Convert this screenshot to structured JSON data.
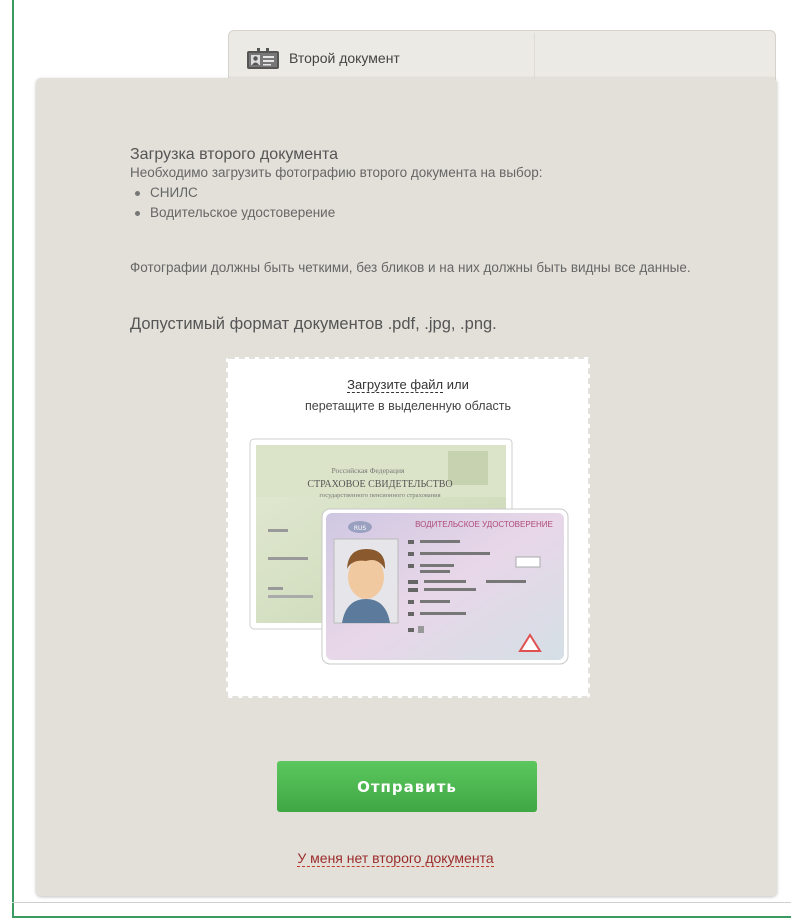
{
  "tab": {
    "label": "Второй документ",
    "icon": "id-card-icon"
  },
  "content": {
    "title": "Загрузка второго документа",
    "intro": "Необходимо загрузить фотографию второго документа на выбор:",
    "documents": [
      "СНИЛС",
      "Водительское удостоверение"
    ],
    "photo_note": "Фотографии должны быть четкими, без бликов и на них должны быть видны все данные.",
    "formats": "Допустимый формат документов .pdf, .jpg, .png."
  },
  "dropzone": {
    "upload_link": "Загрузите файл",
    "upload_suffix": " или",
    "drag_hint": "перетащите в выделенную область",
    "snils": {
      "country": "Российская Федерация",
      "title_line1": "СТРАХОВОЕ СВИДЕТЕЛЬСТВО",
      "title_line2": "государственного пенсионного страхования"
    },
    "license": {
      "title": "ВОДИТЕЛЬСКОЕ УДОСТОВЕРЕНИЕ",
      "country_code": "RUS"
    }
  },
  "actions": {
    "submit_label": "Отправить",
    "no_document_label": "У меня нет второго документа"
  },
  "colors": {
    "frame": "#3a9a62",
    "panel": "#e2e0d9",
    "submit": "#4cb84f",
    "link": "#9b2b2b"
  }
}
